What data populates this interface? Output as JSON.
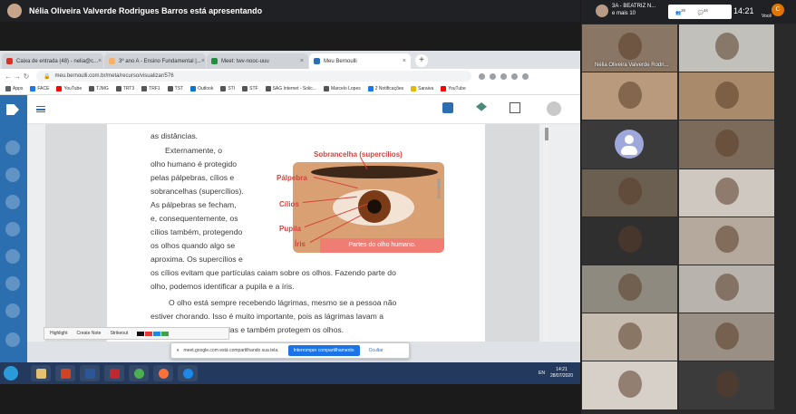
{
  "presenter_bar": {
    "text": "Nélia Oliveira Valverde Rodrigues Barros está apresentando"
  },
  "browser": {
    "tabs": [
      {
        "label": "Caixa de entrada (48) - nelia@c...",
        "color": "#d93025",
        "active": false
      },
      {
        "label": "3º ano A - Ensino Fundamental |...",
        "color": "#f6b26b",
        "active": false
      },
      {
        "label": "Meet: twv-nooc-uuu",
        "color": "#1e8e3e",
        "active": false
      },
      {
        "label": "Meu Bernoulli",
        "color": "#2c6fb0",
        "active": true
      }
    ],
    "new_tab": "+",
    "close_glyph": "×",
    "url": "meu.bernoulli.com.br/meta/recurso/visualizar/576",
    "bookmarks": [
      {
        "label": "Apps",
        "color": "#5f6368"
      },
      {
        "label": "FACE",
        "color": "#1877f2"
      },
      {
        "label": "YouTube",
        "color": "#ff0000"
      },
      {
        "label": "TJMG",
        "color": "#555555"
      },
      {
        "label": "TRT3",
        "color": "#555555"
      },
      {
        "label": "TRF1",
        "color": "#555555"
      },
      {
        "label": "TST",
        "color": "#555555"
      },
      {
        "label": "Outlook",
        "color": "#0078d4"
      },
      {
        "label": "STI",
        "color": "#555555"
      },
      {
        "label": "STF",
        "color": "#555555"
      },
      {
        "label": "SAG Internet - Solic...",
        "color": "#555555"
      },
      {
        "label": "Marcelo Lopes",
        "color": "#555555"
      },
      {
        "label": "2 Notificações",
        "color": "#1877f2"
      },
      {
        "label": "Saraiva",
        "color": "#e6b800"
      },
      {
        "label": "YouTube",
        "color": "#ff0000"
      }
    ]
  },
  "document": {
    "lines": [
      "as distâncias.",
      "Externamente, o",
      "olho humano é protegido",
      "pelas pálpebras, cílios e",
      "sobrancelhas (supercílios).",
      "As pálpebras se fecham,",
      "e, consequentemente, os",
      "cílios também, protegendo",
      "os olhos quando algo se",
      "aproxima. Os supercílios e",
      "os cílios evitam que partículas caiam sobre os olhos. Fazendo parte do",
      "olho, podemos identificar a pupila e a íris.",
      "O olho está sempre recebendo lágrimas, mesmo se a pessoa não",
      "estiver chorando. Isso é muito importante, pois as lágrimas lavam a",
      "poeira e outras partículas e também protegem os olhos."
    ],
    "figure": {
      "labels": {
        "eyebrow": "Sobrancelha (supercílios)",
        "eyelid": "Pálpebra",
        "lashes": "Cílios",
        "pupil": "Pupila",
        "iris": "Íris"
      },
      "caption": "Partes do olho humano."
    }
  },
  "annotation_toolbar": {
    "highlight": "Highlight",
    "create_note": "Create Note",
    "strikeout": "Strikeout"
  },
  "share_banner": {
    "text": "meet.google.com está compartilhando sua tela.",
    "stop_button": "Interromper compartilhamento",
    "hide_button": "Ocultar"
  },
  "taskbar": {
    "lang": "EN",
    "time": "14:21",
    "date": "28/07/2020"
  },
  "meet": {
    "top_participant": {
      "name": "3A - BEATRIZ N...",
      "more": "e mais 10"
    },
    "chat_count": "29",
    "people_count": "44",
    "time": "14:21",
    "user_initial": "C",
    "you_label": "Você",
    "tiles": [
      {
        "name": "Nélia Oliveira Valverde Rodri...",
        "color": "#8a7665"
      },
      {
        "name": "",
        "color": "#c2c0bb"
      },
      {
        "name": "",
        "color": "#b99a7d"
      },
      {
        "name": "",
        "color": "#a98a6a"
      },
      {
        "name": "",
        "color": "#3a3a3a",
        "avatar": true
      },
      {
        "name": "",
        "color": "#7c6a5a"
      },
      {
        "name": "",
        "color": "#6b5f52"
      },
      {
        "name": "",
        "color": "#cfc8c0"
      },
      {
        "name": "",
        "color": "#2f2f2f"
      },
      {
        "name": "",
        "color": "#b4a99c"
      },
      {
        "name": "",
        "color": "#8f8a80"
      },
      {
        "name": "",
        "color": "#b8b3ad"
      },
      {
        "name": "",
        "color": "#c6bcb0"
      },
      {
        "name": "",
        "color": "#9a8f84"
      },
      {
        "name": "",
        "color": "#d7d0c9"
      },
      {
        "name": "",
        "color": "#3b3b3b"
      }
    ]
  }
}
